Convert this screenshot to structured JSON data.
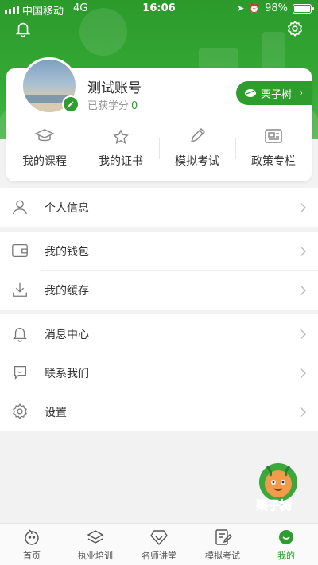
{
  "status_bar": {
    "carrier": "中国移动",
    "network": "4G",
    "time": "16:06",
    "battery": "98%",
    "battery_level": 0.98
  },
  "profile": {
    "name": "测试账号",
    "credits_label": "已获学分",
    "credits_value": "0",
    "brand_button": "栗子树"
  },
  "quick_actions": [
    {
      "label": "我的课程",
      "icon": "graduation-cap-icon"
    },
    {
      "label": "我的证书",
      "icon": "star-certificate-icon"
    },
    {
      "label": "模拟考试",
      "icon": "pencil-icon"
    },
    {
      "label": "政策专栏",
      "icon": "policy-card-icon"
    }
  ],
  "menu": {
    "group1": [
      {
        "label": "个人信息",
        "icon": "person-icon"
      }
    ],
    "group2": [
      {
        "label": "我的钱包",
        "icon": "wallet-icon"
      },
      {
        "label": "我的缓存",
        "icon": "download-icon"
      }
    ],
    "group3": [
      {
        "label": "消息中心",
        "icon": "bell-icon"
      },
      {
        "label": "联系我们",
        "icon": "chat-icon"
      },
      {
        "label": "设置",
        "icon": "gear-icon"
      }
    ]
  },
  "mascot": {
    "label": "栗子树"
  },
  "tab_bar": [
    {
      "label": "首页",
      "icon": "home-icon"
    },
    {
      "label": "执业培训",
      "icon": "layers-icon"
    },
    {
      "label": "名师讲堂",
      "icon": "diamond-icon"
    },
    {
      "label": "模拟考试",
      "icon": "exam-icon"
    },
    {
      "label": "我的",
      "icon": "me-icon",
      "active": true
    }
  ],
  "colors": {
    "primary": "#2e9d2e",
    "background": "#f2f2f2"
  }
}
